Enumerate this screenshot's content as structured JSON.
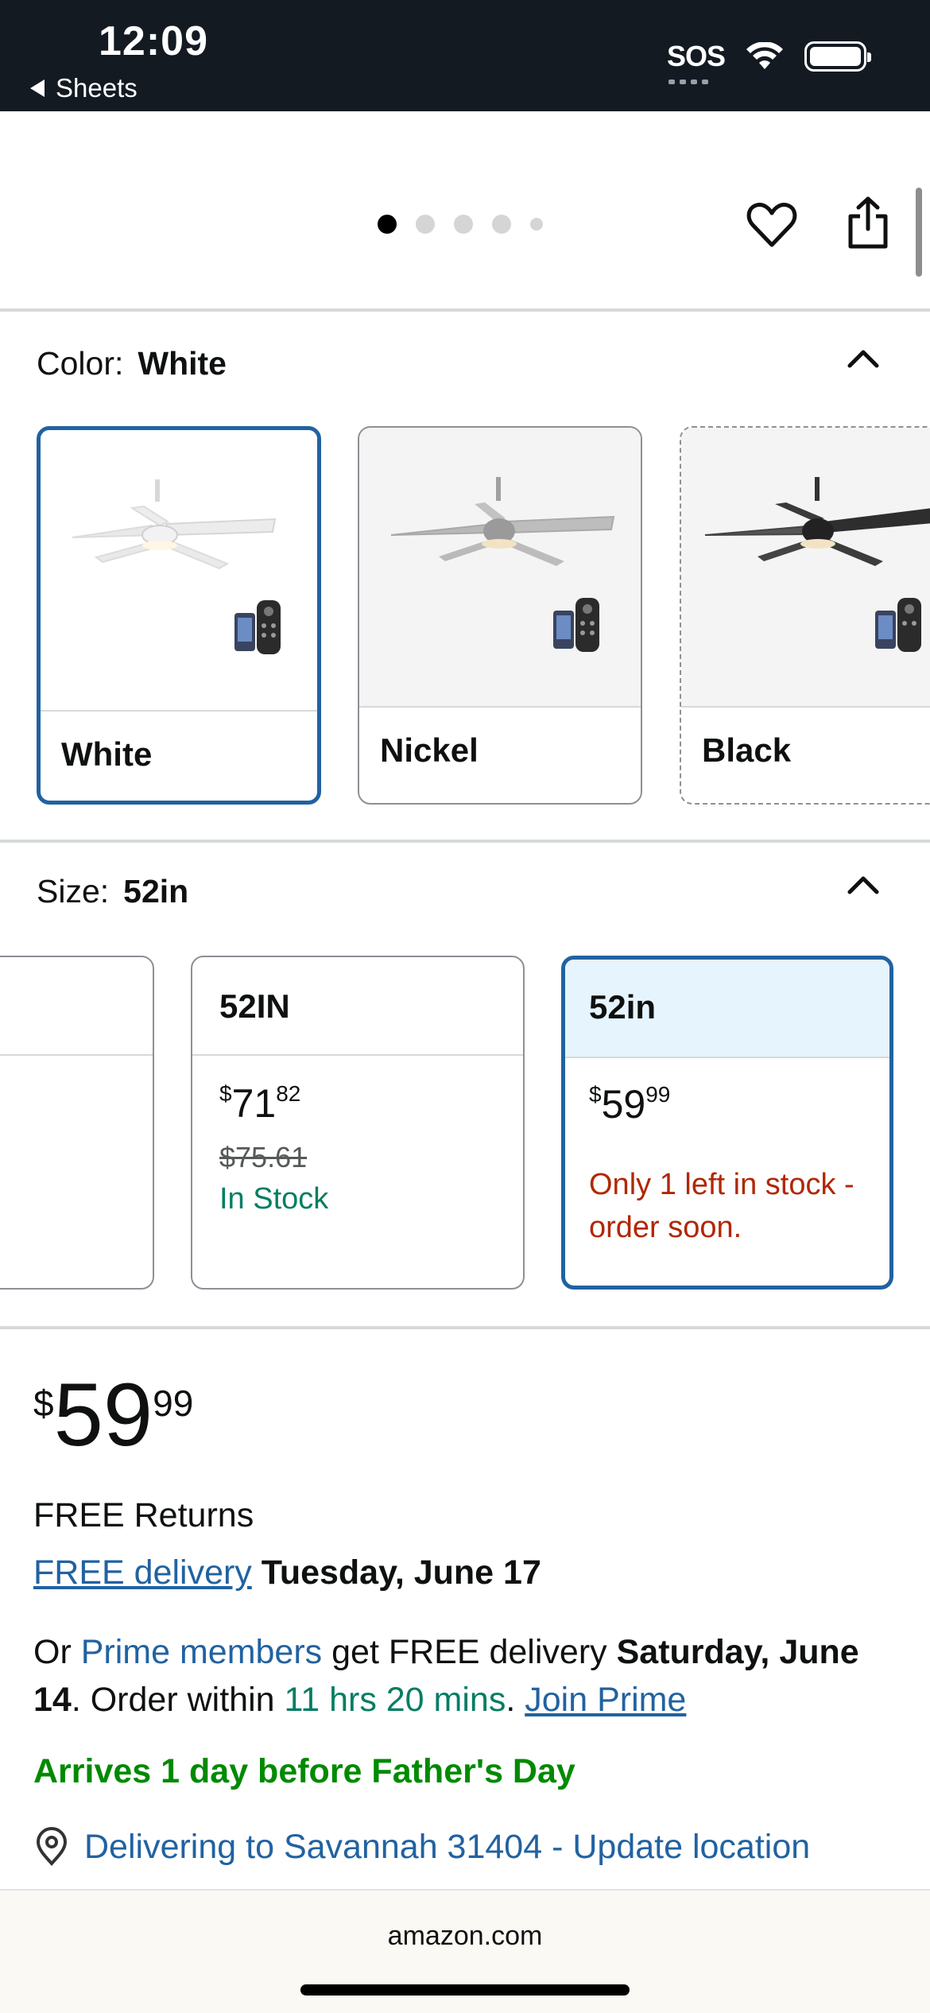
{
  "status_bar": {
    "time": "12:09",
    "back_label": "Sheets",
    "sos": "SOS"
  },
  "carousel": {
    "dot_count": 5,
    "active_index": 0
  },
  "color": {
    "label": "Color:",
    "selected": "White",
    "options": [
      {
        "name": "White",
        "selected": true
      },
      {
        "name": "Nickel",
        "selected": false
      },
      {
        "name": "Black",
        "selected": false,
        "unavailable": true
      }
    ]
  },
  "size": {
    "label": "Size:",
    "selected": "52in",
    "options": [
      {
        "name": "52IN",
        "price_whole": "71",
        "price_frac": "82",
        "currency": "$",
        "list_price": "$75.61",
        "availability": "In Stock"
      },
      {
        "name": "52in",
        "price_whole": "59",
        "price_frac": "99",
        "currency": "$",
        "availability": "Only 1 left in stock - order soon."
      }
    ]
  },
  "price": {
    "currency": "$",
    "whole": "59",
    "fraction": "99"
  },
  "delivery": {
    "free_returns": "FREE Returns",
    "free_delivery_link": "FREE delivery",
    "free_delivery_date": "Tuesday, June 17",
    "prime_prefix": "Or",
    "prime_members_link": "Prime members",
    "prime_mid": "get FREE delivery",
    "prime_date_1": "Saturday, June",
    "prime_date_2": "14",
    "order_within_prefix": ". Order within",
    "countdown": "11 hrs 20 mins",
    "join_prime": "Join Prime",
    "arrives": "Arrives 1 day before Father's Day",
    "location": "Delivering to Savannah 31404 - Update location"
  },
  "browser": {
    "url": "amazon.com"
  },
  "colors": {
    "link": "#2162a1",
    "selected_border": "#2162a1",
    "in_stock": "#067d62",
    "low_stock": "#b12704",
    "arrives": "#008a00"
  }
}
